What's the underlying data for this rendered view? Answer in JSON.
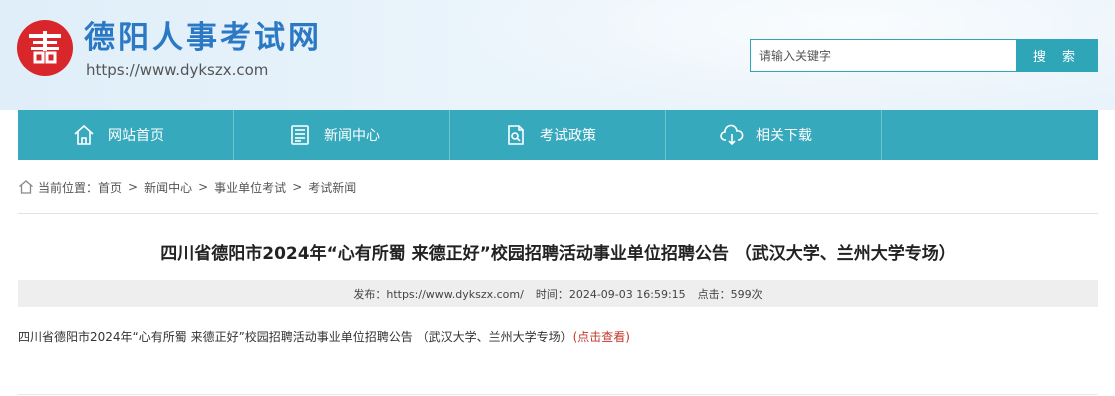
{
  "site": {
    "title": "德阳人事考试网",
    "url": "https://www.dykszx.com"
  },
  "search": {
    "placeholder": "请输入关键字",
    "button_label": "搜 索"
  },
  "nav": [
    {
      "label": "网站首页",
      "icon": "home-icon"
    },
    {
      "label": "新闻中心",
      "icon": "news-icon"
    },
    {
      "label": "考试政策",
      "icon": "policy-document-icon"
    },
    {
      "label": "相关下载",
      "icon": "cloud-download-icon"
    }
  ],
  "breadcrumb": {
    "prefix": "当前位置：",
    "items": [
      "首页",
      "新闻中心",
      "事业单位考试",
      "考试新闻"
    ],
    "separator": ">"
  },
  "article": {
    "title": "四川省德阳市2024年“心有所蜀 来德正好”校园招聘活动事业单位招聘公告 （武汉大学、兰州大学专场）",
    "meta": {
      "publish": "发布：https://www.dykszx.com/",
      "time": "时间：2024-09-03 16:59:15",
      "clicks": "点击：599次"
    },
    "body_text": "四川省德阳市2024年“心有所蜀 来德正好”校园招聘活动事业单位招聘公告 （武汉大学、兰州大学专场）",
    "link_text": "(点击查看)"
  },
  "colors": {
    "accent": "#36a9bd",
    "title_blue": "#2b78c4",
    "seal_red": "#d8262b",
    "link_red": "#c0392b"
  }
}
